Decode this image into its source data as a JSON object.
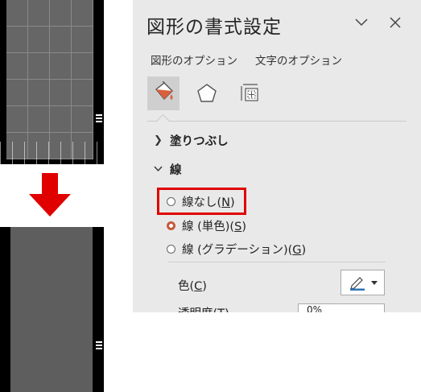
{
  "pane": {
    "title": "図形の書式設定",
    "tabs": [
      "図形のオプション",
      "文字のオプション"
    ],
    "sections": {
      "fill": "塗りつぶし",
      "line": "線"
    },
    "line_options": [
      {
        "text": "線なし(",
        "key": "N",
        "tail": ")",
        "checked": false
      },
      {
        "text": "線 (単色)(",
        "key": "S",
        "tail": ")",
        "checked": true
      },
      {
        "text": "線 (グラデーション)(",
        "key": "G",
        "tail": ")",
        "checked": false
      }
    ],
    "color": {
      "text": "色(",
      "key": "C",
      "tail": ")"
    },
    "cutoff_label": "透明度(T)",
    "cutoff_value": "0%"
  },
  "colors": {
    "pane_bg": "#e9e9e9",
    "highlight": "#e00000",
    "arrow": "#e00000",
    "radio_checked": "#c55a3a"
  },
  "icons": [
    "fill-line-icon",
    "effects-pentagon-icon",
    "size-properties-icon",
    "close-icon",
    "collapse-icon",
    "down-arrow-icon",
    "pen-color-icon",
    "chevron-down-icon"
  ]
}
